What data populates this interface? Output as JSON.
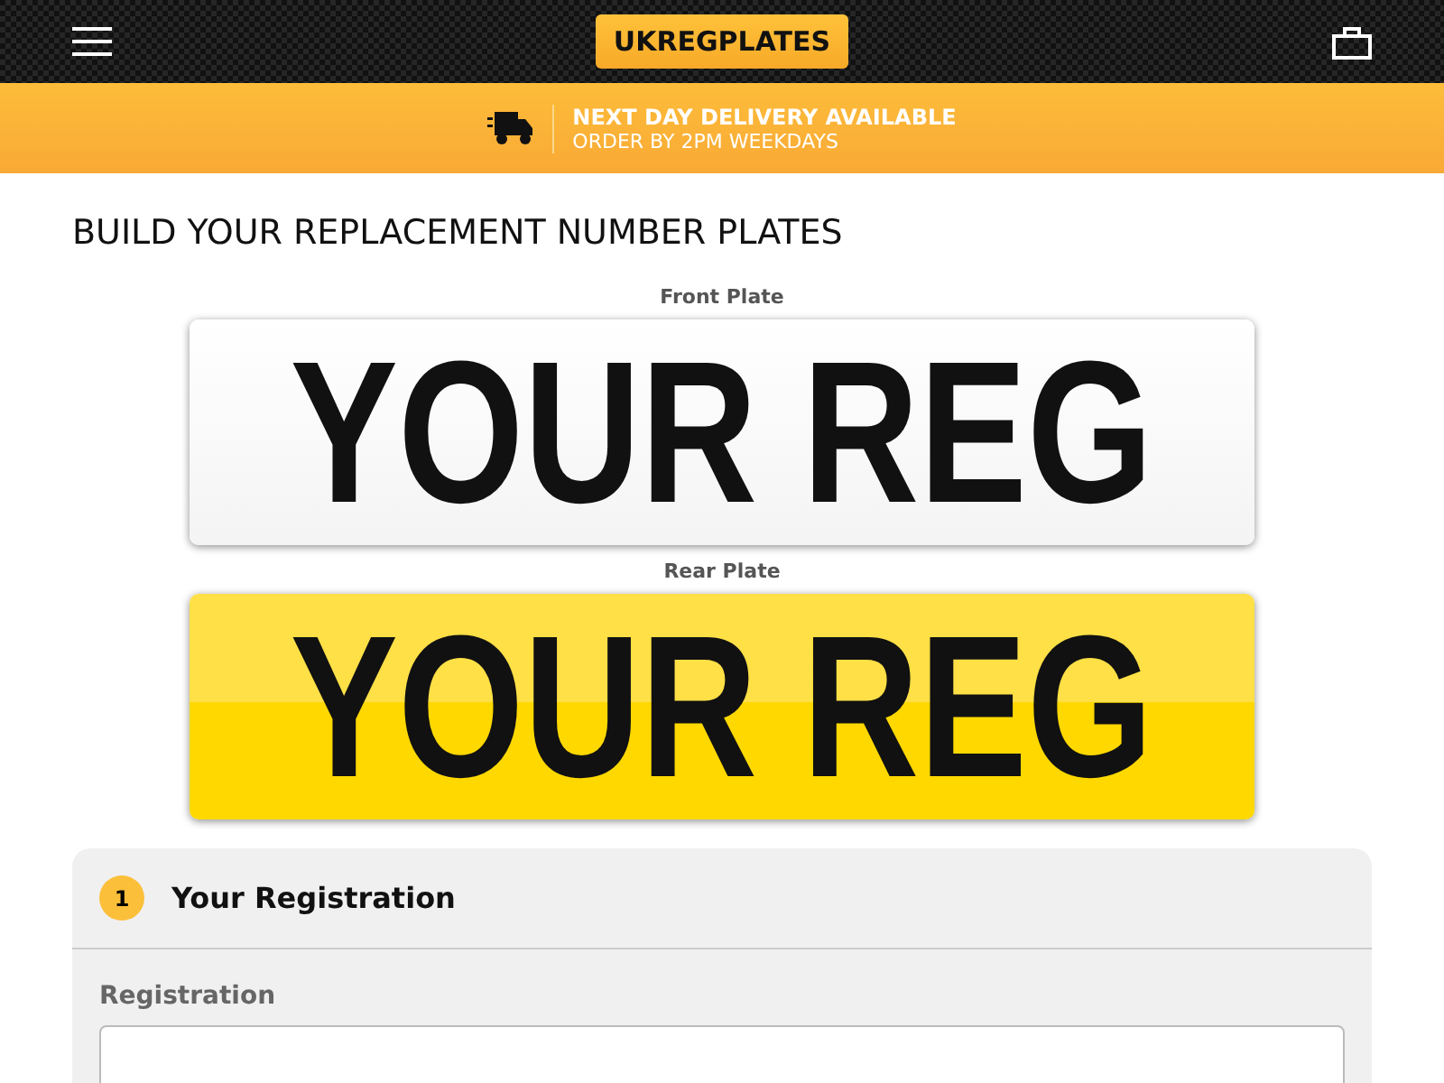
{
  "header": {
    "logo": "UKREGPLATES"
  },
  "banner": {
    "title": "NEXT DAY DELIVERY AVAILABLE",
    "subtitle": "ORDER BY 2PM WEEKDAYS"
  },
  "page_title": "BUILD YOUR REPLACEMENT NUMBER PLATES",
  "plates": [
    {
      "label": "Front Plate",
      "text": "YOUR REG",
      "kind": "front"
    },
    {
      "label": "Rear Plate",
      "text": "YOUR REG",
      "kind": "rear"
    }
  ],
  "step": {
    "number": "1",
    "title": "Your Registration",
    "field_label": "Registration"
  }
}
